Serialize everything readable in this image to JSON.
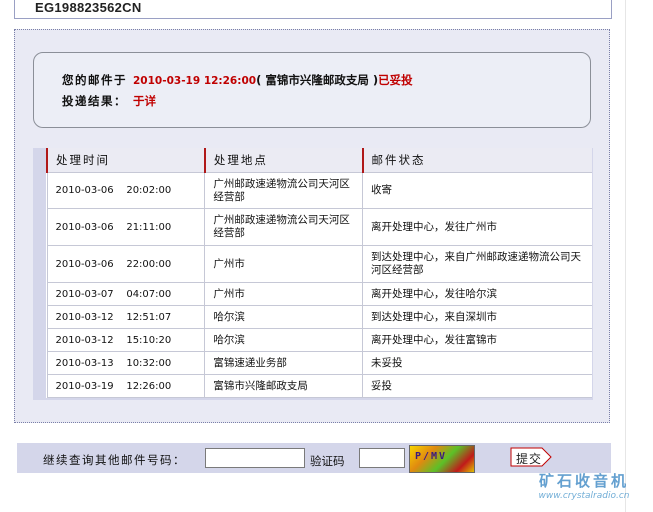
{
  "tracking_number": "EG198823562CN",
  "summary": {
    "mail_label": "您的邮件于",
    "datetime": "2010-03-19 12:26:00",
    "office": "( 富锦市兴隆邮政支局 )",
    "status": "已妥投",
    "result_label": "投递结果：",
    "recipient": "于详"
  },
  "table": {
    "headers": [
      "处理时间",
      "处理地点",
      "邮件状态"
    ],
    "rows": [
      {
        "time": "2010-03-06    20:02:00",
        "place": "广州邮政速递物流公司天河区经营部",
        "status": "收寄"
      },
      {
        "time": "2010-03-06    21:11:00",
        "place": "广州邮政速递物流公司天河区经营部",
        "status": "离开处理中心，发往广州市"
      },
      {
        "time": "2010-03-06    22:00:00",
        "place": "广州市",
        "status": "到达处理中心，来自广州邮政速递物流公司天河区经营部"
      },
      {
        "time": "2010-03-07    04:07:00",
        "place": "广州市",
        "status": "离开处理中心，发往哈尔滨"
      },
      {
        "time": "2010-03-12    12:51:07",
        "place": "哈尔滨",
        "status": "到达处理中心，来自深圳市"
      },
      {
        "time": "2010-03-12    15:10:20",
        "place": "哈尔滨",
        "status": "离开处理中心，发往富锦市"
      },
      {
        "time": "2010-03-13    10:32:00",
        "place": "富锦速递业务部",
        "status": "未妥投"
      },
      {
        "time": "2010-03-19    12:26:00",
        "place": "富锦市兴隆邮政支局",
        "status": "妥投"
      }
    ]
  },
  "query": {
    "label": "继续查询其他邮件号码：",
    "tracking_input_value": "",
    "code_label": "验证码",
    "code_input_value": "",
    "captcha_text": "P/MV",
    "submit_label": "提交"
  },
  "watermark": {
    "title": "矿石收音机",
    "url": "www.crystalradio.cn"
  },
  "colors": {
    "accent_red": "#c00000",
    "panel_bg": "#e9eaf4",
    "table_frame": "#d4d6ea",
    "watermark_blue": "#4a90c8"
  }
}
